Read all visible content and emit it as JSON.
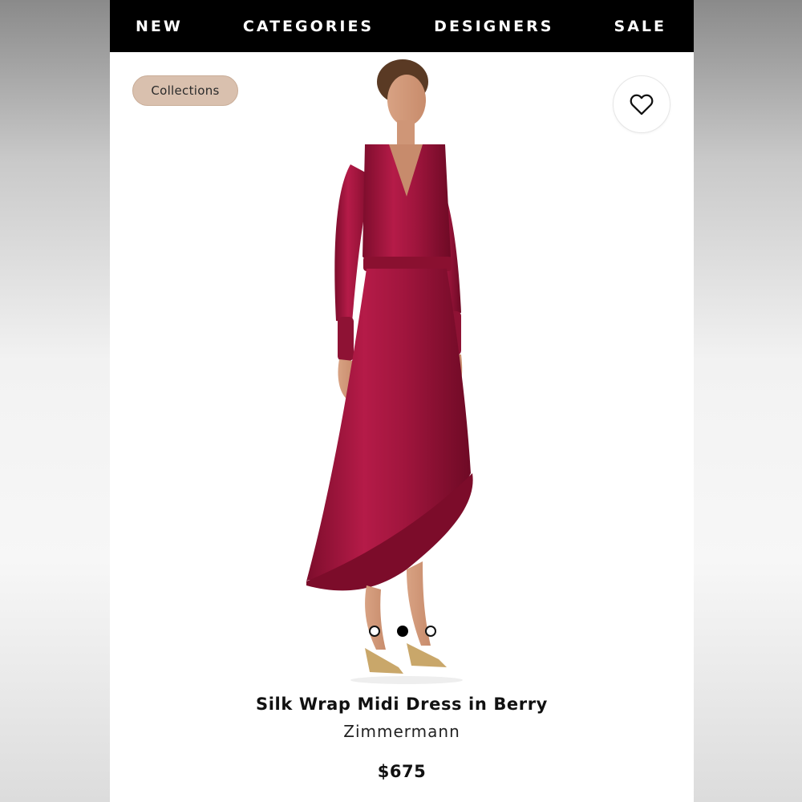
{
  "nav": {
    "items": [
      "NEW",
      "CATEGORIES",
      "DESIGNERS",
      "SALE"
    ],
    "background": "#000000",
    "text_color": "#ffffff"
  },
  "chip": {
    "label": "Collections",
    "color": "#d9c0ae"
  },
  "favorite": {
    "icon": "heart-icon"
  },
  "product": {
    "name": "Silk Wrap Midi Dress in Berry",
    "brand": "Zimmermann",
    "price": "$675",
    "dress_color": "#a8163f"
  },
  "gallery": {
    "total": 3,
    "active_index": 1
  }
}
